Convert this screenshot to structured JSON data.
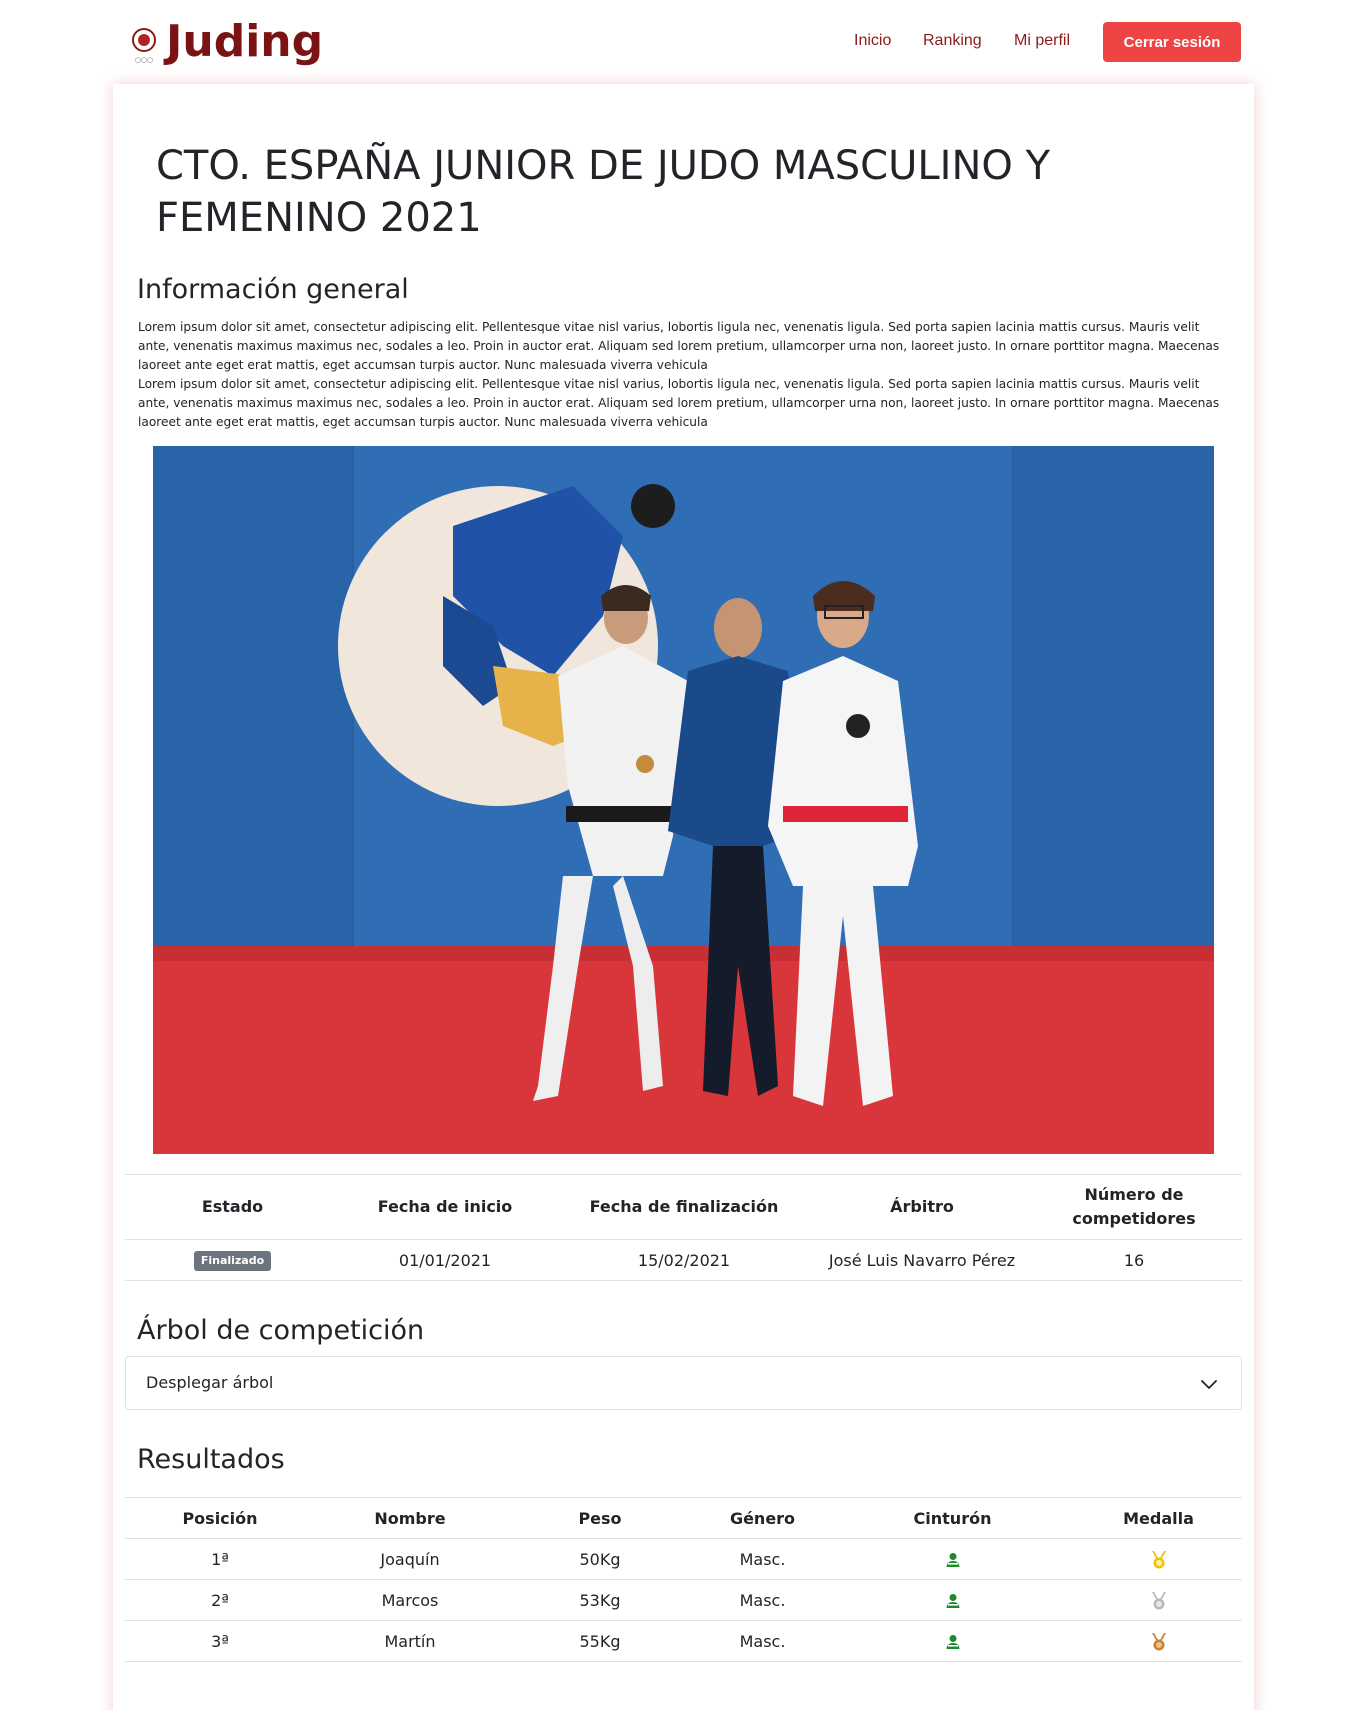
{
  "brand": {
    "name": "Juding"
  },
  "nav": {
    "links": [
      "Inicio",
      "Ranking",
      "Mi perfil"
    ],
    "logout": "Cerrar sesión"
  },
  "tournament": {
    "title": "CTO. ESPAÑA JUNIOR DE JUDO MASCULINO Y FEMENINO 2021"
  },
  "general": {
    "heading": "Información general",
    "paragraphs": [
      "Lorem ipsum dolor sit amet, consectetur adipiscing elit. Pellentesque vitae nisl varius, lobortis ligula nec, venenatis ligula. Sed porta sapien lacinia mattis cursus. Mauris velit ante, venenatis maximus maximus nec, sodales a leo. Proin in auctor erat. Aliquam sed lorem pretium, ullamcorper urna non, laoreet justo. In ornare porttitor magna. Maecenas laoreet ante eget erat mattis, eget accumsan turpis auctor. Nunc malesuada viverra vehicula",
      "Lorem ipsum dolor sit amet, consectetur adipiscing elit. Pellentesque vitae nisl varius, lobortis ligula nec, venenatis ligula. Sed porta sapien lacinia mattis cursus. Mauris velit ante, venenatis maximus maximus nec, sodales a leo. Proin in auctor erat. Aliquam sed lorem pretium, ullamcorper urna non, laoreet justo. In ornare porttitor magna. Maecenas laoreet ante eget erat mattis, eget accumsan turpis auctor. Nunc malesuada viverra vehicula"
    ]
  },
  "details": {
    "headers": [
      "Estado",
      "Fecha de inicio",
      "Fecha de finalización",
      "Árbitro",
      "Número de competidores"
    ],
    "status": "Finalizado",
    "start_date": "01/01/2021",
    "end_date": "15/02/2021",
    "referee": "José Luis Navarro Pérez",
    "competitors": "16"
  },
  "tree": {
    "heading": "Árbol de competición",
    "toggle": "Desplegar árbol"
  },
  "results": {
    "heading": "Resultados",
    "headers": [
      "Posición",
      "Nombre",
      "Peso",
      "Género",
      "Cinturón",
      "Medalla"
    ],
    "rows": [
      {
        "position": "1ª",
        "name": "Joaquín",
        "weight": "50Kg",
        "gender": "Masc.",
        "belt": "green-belt-icon",
        "medal": "gold-medal-icon"
      },
      {
        "position": "2ª",
        "name": "Marcos",
        "weight": "53Kg",
        "gender": "Masc.",
        "belt": "green-belt-icon",
        "medal": "silver-medal-icon"
      },
      {
        "position": "3ª",
        "name": "Martín",
        "weight": "55Kg",
        "gender": "Masc.",
        "belt": "green-belt-icon",
        "medal": "bronze-medal-icon"
      }
    ]
  },
  "colors": {
    "brand": "#7a1414",
    "nav_link": "#8b1a1a",
    "logout_bg": "#ef4444",
    "badge_bg": "#6c757d",
    "belt_green": "#1e8a2e",
    "gold": "#f2c200",
    "silver": "#b9b9b9",
    "bronze": "#cd7f32"
  }
}
